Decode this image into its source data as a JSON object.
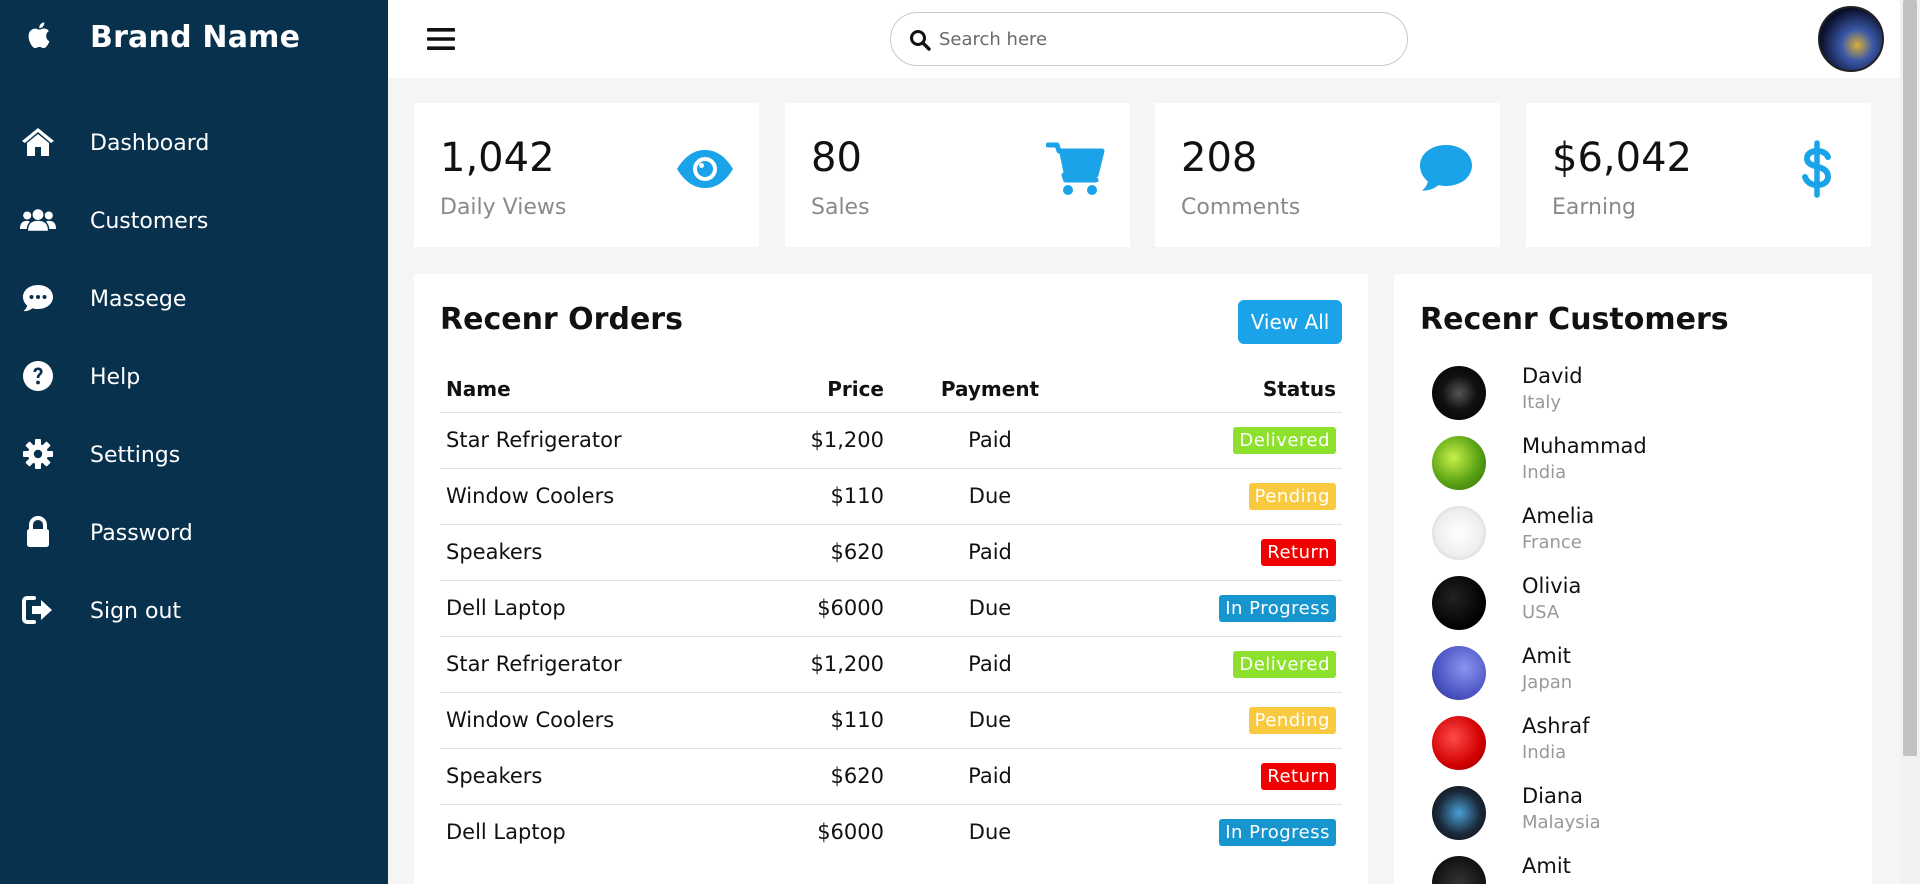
{
  "brand": {
    "name": "Brand Name",
    "icon": "apple-icon"
  },
  "sidebar": {
    "items": [
      {
        "label": "Dashboard",
        "icon": "home-icon"
      },
      {
        "label": "Customers",
        "icon": "users-icon"
      },
      {
        "label": "Massege",
        "icon": "chat-icon"
      },
      {
        "label": "Help",
        "icon": "help-icon"
      },
      {
        "label": "Settings",
        "icon": "gear-icon"
      },
      {
        "label": "Password",
        "icon": "lock-icon"
      },
      {
        "label": "Sign out",
        "icon": "sign-out-icon"
      }
    ]
  },
  "search": {
    "placeholder": "Search here"
  },
  "cards": [
    {
      "value": "1,042",
      "label": "Daily Views",
      "icon": "eye-icon"
    },
    {
      "value": "80",
      "label": "Sales",
      "icon": "cart-icon"
    },
    {
      "value": "208",
      "label": "Comments",
      "icon": "comment-icon"
    },
    {
      "value": "$6,042",
      "label": "Earning",
      "icon": "dollar-icon"
    }
  ],
  "orders": {
    "title": "Recenr Orders",
    "view_all": "View All",
    "columns": [
      "Name",
      "Price",
      "Payment",
      "Status"
    ],
    "rows": [
      {
        "name": "Star Refrigerator",
        "price": "$1,200",
        "payment": "Paid",
        "status": "Delivered"
      },
      {
        "name": "Window Coolers",
        "price": "$110",
        "payment": "Due",
        "status": "Pending"
      },
      {
        "name": "Speakers",
        "price": "$620",
        "payment": "Paid",
        "status": "Return"
      },
      {
        "name": "Dell Laptop",
        "price": "$6000",
        "payment": "Due",
        "status": "In Progress"
      },
      {
        "name": "Star Refrigerator",
        "price": "$1,200",
        "payment": "Paid",
        "status": "Delivered"
      },
      {
        "name": "Window Coolers",
        "price": "$110",
        "payment": "Due",
        "status": "Pending"
      },
      {
        "name": "Speakers",
        "price": "$620",
        "payment": "Paid",
        "status": "Return"
      },
      {
        "name": "Dell Laptop",
        "price": "$6000",
        "payment": "Due",
        "status": "In Progress"
      }
    ]
  },
  "status_colors": {
    "Delivered": "#8de02c",
    "Pending": "#f9ca3f",
    "Return": "#f00000",
    "In Progress": "#1795ce"
  },
  "customers": {
    "title": "Recenr Customers",
    "list": [
      {
        "name": "David",
        "country": "Italy"
      },
      {
        "name": "Muhammad",
        "country": "India"
      },
      {
        "name": "Amelia",
        "country": "France"
      },
      {
        "name": "Olivia",
        "country": "USA"
      },
      {
        "name": "Amit",
        "country": "Japan"
      },
      {
        "name": "Ashraf",
        "country": "India"
      },
      {
        "name": "Diana",
        "country": "Malaysia"
      },
      {
        "name": "Amit",
        "country": ""
      }
    ]
  },
  "colors": {
    "sidebar_bg": "#08314e",
    "accent": "#1aa3e8"
  }
}
